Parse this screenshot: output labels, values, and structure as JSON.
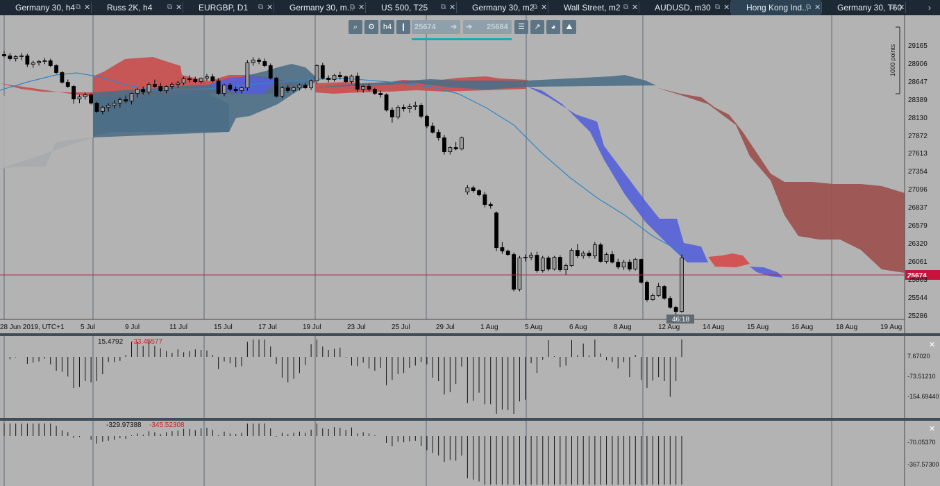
{
  "tabs": [
    {
      "label": "Germany 30, h4",
      "active": false
    },
    {
      "label": "Russ 2K, h4",
      "active": false
    },
    {
      "label": "EURGBP, D1",
      "active": false
    },
    {
      "label": "Germany 30, m...",
      "active": false
    },
    {
      "label": "US 500, T25",
      "active": false
    },
    {
      "label": "Germany 30, m2",
      "active": false
    },
    {
      "label": "Wall Street, m2",
      "active": false
    },
    {
      "label": "AUDUSD, m30",
      "active": false
    },
    {
      "label": "Hong Kong Ind...",
      "active": true
    },
    {
      "label": "Germany 30, T60",
      "active": false
    }
  ],
  "tab_icons": {
    "popout": "popout-icon",
    "close": "close-icon",
    "more": "chevron-right-icon"
  },
  "tab_more_glyph": "›",
  "toolbar": {
    "timeframe": "h4",
    "price_from": "25674",
    "price_to": "25684",
    "icons": [
      "zoom-icon",
      "chart-settings-icon",
      "timeframe-icon",
      "candles-icon",
      "arrow-right-icon",
      "arrow-right-icon",
      "list-icon",
      "indicators-icon",
      "objects-icon",
      "trade-icon"
    ]
  },
  "price_axis": {
    "labels": [
      "29165",
      "28906",
      "28647",
      "28389",
      "28130",
      "27872",
      "27613",
      "27354",
      "27096",
      "26837",
      "26579",
      "26320",
      "26061",
      "25803",
      "25544",
      "25286"
    ],
    "current_price": "25674",
    "scale_label": "1000 points"
  },
  "date_axis": {
    "labels": [
      "28 Jun 2019, UTC+1",
      "5 Jul",
      "9 Jul",
      "11 Jul",
      "15 Jul",
      "17 Jul",
      "19 Jul",
      "23 Jul",
      "25 Jul",
      "29 Jul",
      "1 Aug",
      "5 Aug",
      "6 Aug",
      "8 Aug",
      "12 Aug",
      "14 Aug",
      "15 Aug",
      "16 Aug",
      "18 Aug",
      "19 Aug"
    ],
    "countdown": "46:18"
  },
  "colors": {
    "bull_cloud": "#4c6e86",
    "bear_cloud": "#9b4f4d",
    "tenkan": "#7a4fe0",
    "kijun": "#cc3344",
    "ma": "#2f86c6",
    "price_line": "#a03050",
    "price_tag": "#c8143c"
  },
  "chart_data": [
    {
      "type": "candlestick",
      "title": "Hong Kong Index, h4",
      "ylim": [
        25100,
        29280
      ],
      "x_dates": [
        "28 Jun",
        "5 Jul",
        "9 Jul",
        "11 Jul",
        "15 Jul",
        "17 Jul",
        "19 Jul",
        "23 Jul",
        "25 Jul",
        "29 Jul",
        "1 Aug",
        "5 Aug",
        "6 Aug",
        "8 Aug",
        "12 Aug",
        "14 Aug",
        "15 Aug",
        "16 Aug",
        "18 Aug",
        "19 Aug"
      ],
      "candles": [
        [
          28880,
          28930,
          28840,
          28860
        ],
        [
          28860,
          28900,
          28790,
          28820
        ],
        [
          28820,
          28870,
          28780,
          28850
        ],
        [
          28850,
          28900,
          28800,
          28860
        ],
        [
          28860,
          28890,
          28700,
          28740
        ],
        [
          28740,
          28790,
          28690,
          28760
        ],
        [
          28760,
          28800,
          28720,
          28780
        ],
        [
          28780,
          28830,
          28740,
          28790
        ],
        [
          28790,
          28820,
          28700,
          28720
        ],
        [
          28720,
          28740,
          28600,
          28620
        ],
        [
          28620,
          28640,
          28460,
          28480
        ],
        [
          28480,
          28520,
          28400,
          28420
        ],
        [
          28420,
          28440,
          28170,
          28240
        ],
        [
          28240,
          28300,
          28180,
          28270
        ],
        [
          28270,
          28330,
          28230,
          28300
        ],
        [
          28300,
          28320,
          28160,
          28180
        ],
        [
          28180,
          28200,
          28040,
          28060
        ],
        [
          28060,
          28140,
          28020,
          28120
        ],
        [
          28120,
          28180,
          28060,
          28150
        ],
        [
          28150,
          28220,
          28100,
          28180
        ],
        [
          28180,
          28260,
          28120,
          28230
        ],
        [
          28230,
          28290,
          28180,
          28210
        ],
        [
          28210,
          28330,
          28160,
          28320
        ],
        [
          28320,
          28400,
          28260,
          28380
        ],
        [
          28380,
          28420,
          28300,
          28340
        ],
        [
          28340,
          28480,
          28300,
          28450
        ],
        [
          28450,
          28520,
          28400,
          28420
        ],
        [
          28420,
          28470,
          28340,
          28360
        ],
        [
          28360,
          28440,
          28320,
          28420
        ],
        [
          28420,
          28480,
          28380,
          28450
        ],
        [
          28450,
          28500,
          28400,
          28470
        ],
        [
          28470,
          28560,
          28440,
          28530
        ],
        [
          28530,
          28580,
          28480,
          28520
        ],
        [
          28520,
          28560,
          28470,
          28490
        ],
        [
          28490,
          28550,
          28460,
          28540
        ],
        [
          28540,
          28600,
          28500,
          28560
        ],
        [
          28560,
          28600,
          28480,
          28500
        ],
        [
          28500,
          28540,
          28300,
          28320
        ],
        [
          28320,
          28460,
          28280,
          28440
        ],
        [
          28440,
          28470,
          28350,
          28380
        ],
        [
          28380,
          28420,
          28330,
          28360
        ],
        [
          28360,
          28420,
          28320,
          28400
        ],
        [
          28400,
          28800,
          28360,
          28760
        ],
        [
          28760,
          28840,
          28720,
          28800
        ],
        [
          28800,
          28830,
          28740,
          28780
        ],
        [
          28780,
          28820,
          28700,
          28720
        ],
        [
          28720,
          28750,
          28520,
          28540
        ],
        [
          28540,
          28560,
          28260,
          28280
        ],
        [
          28280,
          28420,
          28250,
          28400
        ],
        [
          28400,
          28440,
          28330,
          28360
        ],
        [
          28360,
          28420,
          28330,
          28400
        ],
        [
          28400,
          28460,
          28360,
          28440
        ],
        [
          28440,
          28470,
          28380,
          28400
        ],
        [
          28400,
          28520,
          28370,
          28500
        ],
        [
          28500,
          28740,
          28460,
          28720
        ],
        [
          28720,
          28760,
          28520,
          28540
        ],
        [
          28540,
          28580,
          28480,
          28520
        ],
        [
          28520,
          28600,
          28490,
          28580
        ],
        [
          28580,
          28630,
          28520,
          28560
        ],
        [
          28560,
          28580,
          28470,
          28490
        ],
        [
          28490,
          28590,
          28460,
          28570
        ],
        [
          28570,
          28620,
          28340,
          28380
        ],
        [
          28380,
          28440,
          28330,
          28420
        ],
        [
          28420,
          28460,
          28350,
          28380
        ],
        [
          28380,
          28400,
          28300,
          28320
        ],
        [
          28320,
          28360,
          28260,
          28300
        ],
        [
          28300,
          28320,
          28060,
          28080
        ],
        [
          28080,
          28120,
          27900,
          27980
        ],
        [
          27980,
          28150,
          27950,
          28120
        ],
        [
          28120,
          28160,
          28060,
          28100
        ],
        [
          28100,
          28170,
          28040,
          28130
        ],
        [
          28130,
          28200,
          28080,
          28150
        ],
        [
          28150,
          28180,
          27960,
          27990
        ],
        [
          27990,
          28010,
          27820,
          27850
        ],
        [
          27850,
          27900,
          27740,
          27760
        ],
        [
          27760,
          27800,
          27640,
          27680
        ],
        [
          27680,
          27720,
          27440,
          27480
        ],
        [
          27480,
          27560,
          27440,
          27540
        ],
        [
          27540,
          27620,
          27500,
          27520
        ],
        [
          27520,
          27700,
          27500,
          27680
        ],
        [
          26900,
          27000,
          26860,
          26960
        ],
        [
          26960,
          26990,
          26890,
          26920
        ],
        [
          26920,
          26940,
          26840,
          26860
        ],
        [
          26860,
          26900,
          26680,
          26720
        ],
        [
          26720,
          26750,
          26660,
          26700
        ],
        [
          26600,
          26620,
          26050,
          26100
        ],
        [
          26100,
          26180,
          26010,
          26050
        ],
        [
          26050,
          26070,
          25980,
          26000
        ],
        [
          26000,
          26030,
          25470,
          25500
        ],
        [
          25500,
          25980,
          25470,
          25950
        ],
        [
          25950,
          26000,
          25900,
          25960
        ],
        [
          25960,
          26030,
          25920,
          25990
        ],
        [
          25990,
          26040,
          25740,
          25770
        ],
        [
          25770,
          25980,
          25740,
          25950
        ],
        [
          25950,
          25980,
          25760,
          25790
        ],
        [
          25790,
          25980,
          25770,
          25960
        ],
        [
          25960,
          25990,
          25750,
          25780
        ],
        [
          25780,
          25870,
          25700,
          25840
        ],
        [
          25840,
          26090,
          25820,
          26060
        ],
        [
          26060,
          26150,
          25950,
          25980
        ],
        [
          25980,
          26050,
          25940,
          26020
        ],
        [
          26020,
          26060,
          25950,
          25980
        ],
        [
          25980,
          26180,
          25940,
          26140
        ],
        [
          26140,
          26170,
          25880,
          25900
        ],
        [
          25900,
          26030,
          25870,
          26000
        ],
        [
          26000,
          26050,
          25870,
          25890
        ],
        [
          25890,
          25940,
          25790,
          25820
        ],
        [
          25820,
          25920,
          25780,
          25890
        ],
        [
          25890,
          25930,
          25760,
          25790
        ],
        [
          25790,
          25950,
          25770,
          25930
        ],
        [
          25930,
          25940,
          25580,
          25600
        ],
        [
          25600,
          25620,
          25320,
          25350
        ],
        [
          25350,
          25440,
          25330,
          25410
        ],
        [
          25410,
          25590,
          25390,
          25540
        ],
        [
          25540,
          25560,
          25350,
          25370
        ],
        [
          25370,
          25400,
          25220,
          25240
        ],
        [
          25240,
          25260,
          25120,
          25180
        ],
        [
          25180,
          26000,
          25160,
          25950
        ]
      ]
    },
    {
      "type": "histogram",
      "values": [
        15.4792,
        -33.45577
      ],
      "ticks": [
        "7.67020",
        "-73.51210",
        "-154.69440"
      ]
    },
    {
      "type": "histogram",
      "values": [
        -329.97388,
        -345.52308
      ],
      "ticks": [
        "-70.05370",
        "-367.57300"
      ]
    }
  ],
  "osc1_val1": "15.4792",
  "osc1_val2": "-33.45577",
  "osc2_val1": "-329.97388",
  "osc2_val2": "-345.52308"
}
